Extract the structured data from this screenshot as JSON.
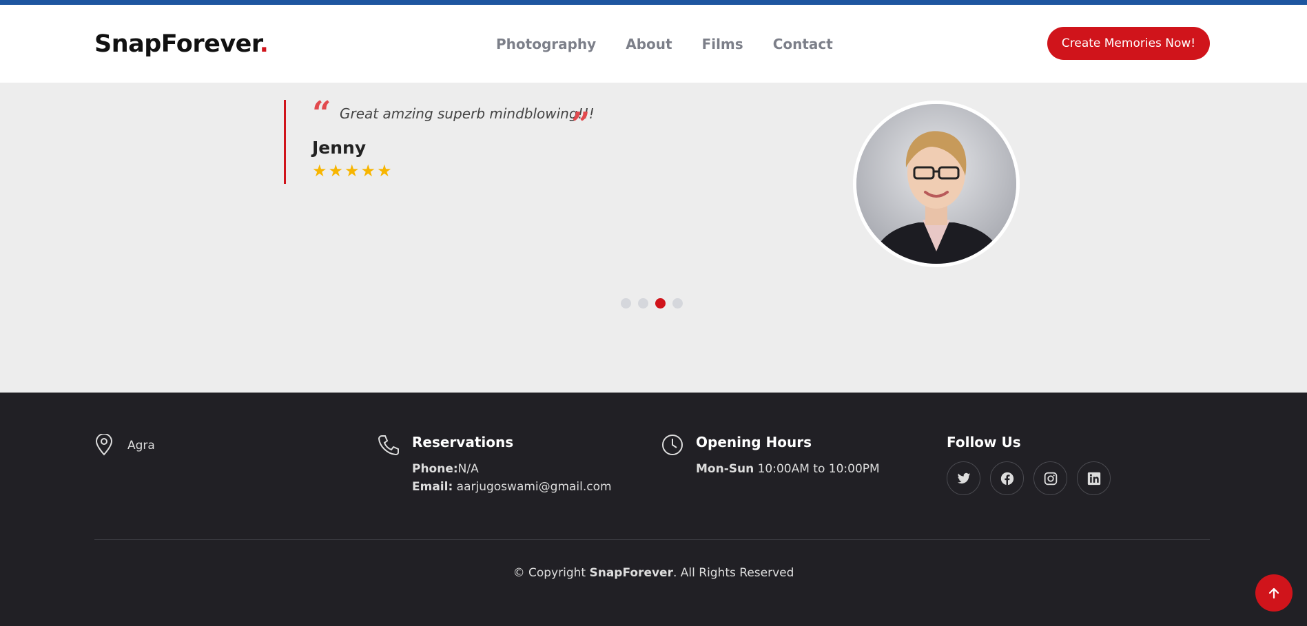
{
  "header": {
    "logo_text": "SnapForever",
    "logo_dot": ".",
    "nav": [
      "Photography",
      "About",
      "Films",
      "Contact"
    ],
    "cta_label": "Create Memories Now!"
  },
  "testimonial": {
    "quote": "Great amzing superb mindblowing!!!",
    "name": "Jenny",
    "rating": 5,
    "slides_total": 4,
    "active_slide": 3
  },
  "footer": {
    "location": "Agra",
    "reservations": {
      "heading": "Reservations",
      "phone_label": "Phone:",
      "phone_value": "N/A",
      "email_label": "Email:",
      "email_value": "aarjugoswami@gmail.com"
    },
    "hours": {
      "heading": "Opening Hours",
      "days": "Mon-Sun",
      "time": "10:00AM to 10:00PM"
    },
    "follow": {
      "heading": "Follow Us",
      "icons": [
        "twitter-icon",
        "facebook-icon",
        "instagram-icon",
        "linkedin-icon"
      ]
    },
    "copyright_prefix": "© Copyright",
    "copyright_brand": "SnapForever",
    "copyright_suffix": ". All Rights Reserved"
  },
  "colors": {
    "accent": "#d0141b",
    "topbar": "#1e56a0",
    "footer_bg": "#212025",
    "section_bg": "#ededed",
    "star": "#f7b500"
  }
}
